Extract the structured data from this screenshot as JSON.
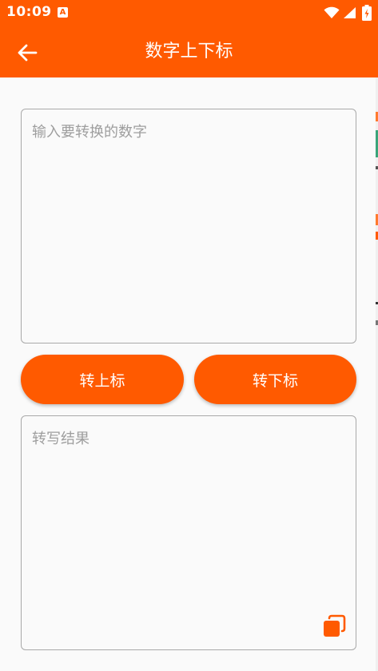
{
  "status_bar": {
    "time": "10:09",
    "notification_letter": "A"
  },
  "header": {
    "title": "数字上下标"
  },
  "input": {
    "placeholder": "输入要转换的数字",
    "value": ""
  },
  "buttons": {
    "superscript_label": "转上标",
    "subscript_label": "转下标"
  },
  "result": {
    "placeholder": "转写结果",
    "value": ""
  },
  "icons": {
    "back": "arrow-left-icon",
    "copy": "copy-icon",
    "wifi": "wifi-icon",
    "signal": "signal-icon",
    "battery": "battery-icon"
  },
  "colors": {
    "accent": "#ff5a00",
    "background": "#fafafa",
    "border": "#a9a9a9",
    "placeholder": "#9e9e9e"
  }
}
